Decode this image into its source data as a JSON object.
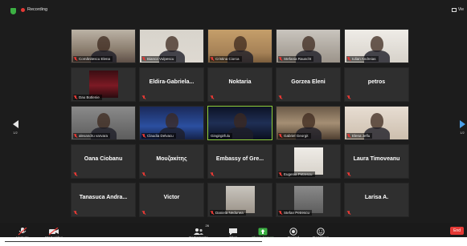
{
  "top": {
    "recording_label": "Recording",
    "view_label": "Vie"
  },
  "gallery": {
    "rows": [
      [
        {
          "name": "Comănitescu Elena",
          "type": "video",
          "bg": "v-room",
          "muted": true
        },
        {
          "name": "Bianca Vulpescu",
          "type": "video",
          "bg": "v-dark",
          "muted": true
        },
        {
          "name": "Cristina Ciorca",
          "type": "video",
          "bg": "v-warm",
          "muted": true
        },
        {
          "name": "Stefania Rauscht",
          "type": "video",
          "bg": "v-office",
          "muted": true
        },
        {
          "name": "Iulian Andreias",
          "type": "video",
          "bg": "v-light",
          "muted": true
        }
      ],
      [
        {
          "name": "Dau Botlenie",
          "type": "image",
          "bg": "v-red",
          "muted": true
        },
        {
          "name": "Eldira-Gabriela...",
          "type": "text",
          "muted": true
        },
        {
          "name": "Noktaria",
          "type": "text",
          "muted": true
        },
        {
          "name": "Gorzea Eleni",
          "type": "text",
          "muted": true
        },
        {
          "name": "petros",
          "type": "text",
          "muted": true
        }
      ],
      [
        {
          "name": "alexandru varvara",
          "type": "video",
          "bg": "v-gray",
          "muted": true
        },
        {
          "name": "Claudia Delvacu",
          "type": "video",
          "bg": "v-blue",
          "muted": true
        },
        {
          "name": "Gingirgirfulu",
          "type": "video",
          "bg": "v-night",
          "muted": false,
          "speaking": true
        },
        {
          "name": "Gabriel Georgit",
          "type": "video",
          "bg": "v-shelf",
          "muted": true
        },
        {
          "name": "Elena Jeflu",
          "type": "video",
          "bg": "v-bright",
          "muted": true
        }
      ],
      [
        {
          "name": "Oana Ciobanu",
          "type": "text",
          "muted": true
        },
        {
          "name": "Μουζακίτης",
          "type": "text",
          "muted": true
        },
        {
          "name": "Embassy of Gre...",
          "type": "text",
          "muted": true
        },
        {
          "name": "Eugenia Petrescu",
          "type": "image",
          "bg": "v-light",
          "muted": true
        },
        {
          "name": "Laura Timoveanu",
          "type": "text",
          "muted": true
        }
      ],
      [
        {
          "name": "Tanasuca Andra...",
          "type": "text",
          "muted": true
        },
        {
          "name": "Victor",
          "type": "text",
          "muted": true
        },
        {
          "name": "Daniela Nedunea",
          "type": "image",
          "bg": "v-office",
          "muted": true
        },
        {
          "name": "Stefan Petrescu",
          "type": "image",
          "bg": "v-gray",
          "muted": true
        },
        {
          "name": "Larisa A.",
          "type": "text",
          "muted": true
        }
      ]
    ]
  },
  "pager": {
    "left": "1/2",
    "right": "1/2"
  },
  "toolbar": {
    "unmute": "Unmute",
    "start_video": "Start Video",
    "participants": "Participants",
    "participants_count": "26",
    "chat": "Chat",
    "share_screen": "Share Screen",
    "record": "Record",
    "reactions": "Reactions",
    "end": "End"
  },
  "colors": {
    "background": "#1c1c1c",
    "tile": "#2f2f2f",
    "speaking_border": "#8fcf3a",
    "muted_red": "#e53935",
    "share_green": "#3cb043"
  }
}
